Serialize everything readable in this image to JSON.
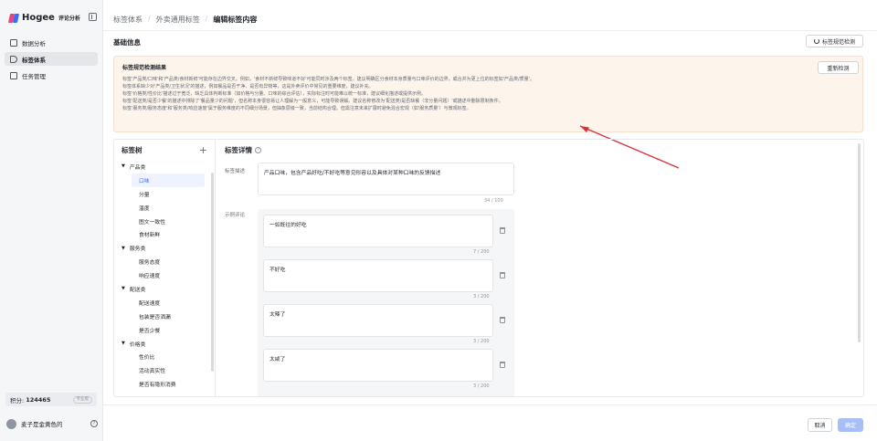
{
  "app": {
    "logo_text": "Hogee",
    "logo_sub": "评论分析"
  },
  "sidebar": {
    "items": [
      {
        "label": "数据分析",
        "icon": "chart-icon",
        "active": false
      },
      {
        "label": "标签体系",
        "icon": "tag-icon",
        "active": true
      },
      {
        "label": "任务管理",
        "icon": "task-icon",
        "active": false
      }
    ],
    "points_label": "积分:",
    "points_value": "124465",
    "points_badge": "专业版",
    "user_name": "麦子是金黄色的"
  },
  "breadcrumb": {
    "items": [
      "标签体系",
      "外卖通用标签"
    ],
    "current": "编辑标签内容",
    "separator": "/"
  },
  "basic_info": {
    "title": "基础信息",
    "check_button": "标签规范检测"
  },
  "check_result": {
    "title": "标签规范检测结果",
    "recheck_button": "重新检测",
    "lines": [
      "标签'产品类/口味'和'产品类/食材新鲜'可能存在边界交叉。例如，'食材不新鲜导致味道不好'可能同时涉及两个标签。建议明确区分食材本身质量与口味评价的边界，或合并为更上位的标签如'产品类/质量'。",
      "标签体系缺少对'产品类/卫生状况'的描述，例如餐品是否干净、是否有异物等，这是外卖评价中常见的重要维度，建议补充。",
      "标签'价格类/性价比'描述过于宽泛，缺乏具体判断标准（如价格与分量、口味的综合评估），实际标注时可能难以统一标准，建议细化描述或提供示例。",
      "标签'配送类/是否少餐'的描述中排除了'餐品量少的问题'，但名称本身很容易让人理解为一般意义，可能导致误解。建议名称修改为'配送类/是否缺餐（非分量问题）'或描述中删除限制条件。",
      "标签'服务类/服务态度'和'服务类/响应速度'属于服务维度的不同细分场景，但抽象层级一致，当前结构合理。但需注意未来扩展时避免混合宏观（如'服务质量'）与微观标签。"
    ]
  },
  "tree": {
    "title": "标签树",
    "add_icon": "+",
    "nodes": [
      {
        "type": "group",
        "label": "产品类"
      },
      {
        "type": "leaf",
        "label": "口味",
        "selected": true
      },
      {
        "type": "leaf",
        "label": "分量"
      },
      {
        "type": "leaf",
        "label": "温度"
      },
      {
        "type": "leaf",
        "label": "图文一致性"
      },
      {
        "type": "leaf",
        "label": "食材新鲜"
      },
      {
        "type": "group",
        "label": "服务类"
      },
      {
        "type": "leaf",
        "label": "服务态度"
      },
      {
        "type": "leaf",
        "label": "响应速度"
      },
      {
        "type": "group",
        "label": "配送类"
      },
      {
        "type": "leaf",
        "label": "配送速度"
      },
      {
        "type": "leaf",
        "label": "包装是否洒漏"
      },
      {
        "type": "leaf",
        "label": "是否少餐"
      },
      {
        "type": "group",
        "label": "价格类"
      },
      {
        "type": "leaf",
        "label": "性价比"
      },
      {
        "type": "leaf",
        "label": "活动真实性"
      },
      {
        "type": "leaf",
        "label": "是否有隐形消费"
      }
    ]
  },
  "detail": {
    "title": "标签详情",
    "desc_label": "标签描述",
    "desc_value": "产品口味，包含产品好吃/不好吃等意见形容以及具体对某种口味的反馈描述",
    "desc_counter": "34 / 100",
    "examples_label": "示例评论",
    "examples": [
      {
        "text": "一如既往的好吃",
        "counter": "7 / 200"
      },
      {
        "text": "不好吃",
        "counter": "3 / 200"
      },
      {
        "text": "太辣了",
        "counter": "3 / 200"
      },
      {
        "text": "太咸了",
        "counter": "3 / 200"
      }
    ]
  },
  "footer": {
    "cancel": "取消",
    "ok": "确定"
  },
  "colors": {
    "accent": "#3370ff",
    "warn_bg": "#fdf4ec",
    "arrow": "#d9323a"
  }
}
